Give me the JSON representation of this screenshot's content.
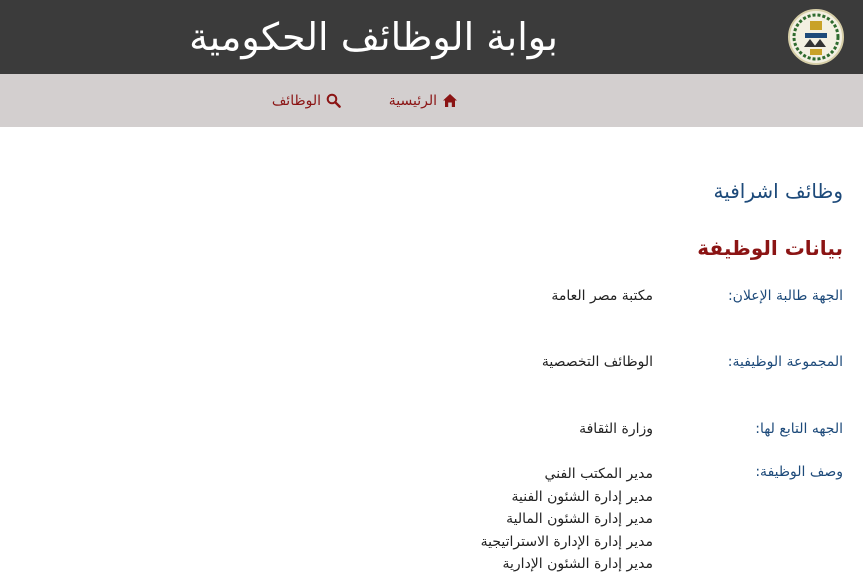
{
  "header": {
    "site_title": "بوابة الوظائف الحكومية",
    "logo_icon": "gov-logo-icon"
  },
  "nav": {
    "home_label": "الرئيسية",
    "home_icon": "home-icon",
    "jobs_label": "الوظائف",
    "jobs_icon": "search-icon"
  },
  "main": {
    "job_category": "وظائف اشرافية",
    "section_title": "بيانات الوظيفة",
    "fields": [
      {
        "label": "الجهة طالبة الإعلان:",
        "value": "مكتبة مصر العامة"
      },
      {
        "label": "المجموعة الوظيفية:",
        "value": "الوظائف التخصصية"
      },
      {
        "label": "الجهه التابع لها:",
        "value": "وزارة الثقافة"
      }
    ],
    "description_label": "وصف الوظيفة:",
    "description_items": [
      "مدير المكتب الفني",
      "مدير إدارة الشئون الفنية",
      "مدير إدارة الشئون المالية",
      "مدير إدارة الإدارة الاستراتيجية",
      "مدير إدارة الشئون الإدارية"
    ]
  },
  "colors": {
    "header_bg": "#3b3b3b",
    "nav_bg": "#d3cfcf",
    "accent_red": "#8b1414",
    "label_blue": "#1d4a7a"
  }
}
